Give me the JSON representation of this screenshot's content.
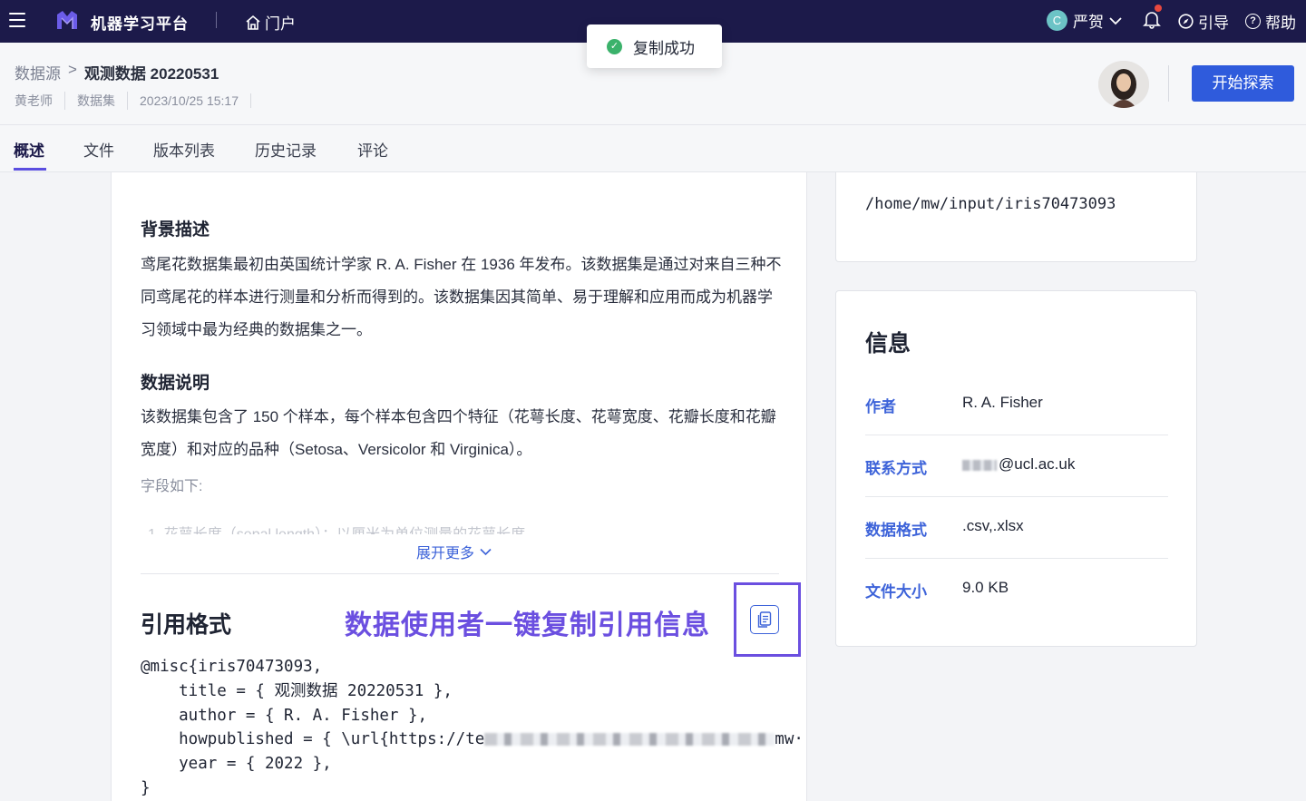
{
  "topbar": {
    "app_title": "机器学习平台",
    "portal_label": "门户",
    "user_initial": "C",
    "user_name": "严贺",
    "guide_label": "引导",
    "help_label": "帮助"
  },
  "toast": {
    "message": "复制成功"
  },
  "header": {
    "breadcrumb_root": "数据源",
    "breadcrumb_sep": ">",
    "breadcrumb_current": "观测数据 20220531",
    "owner": "黄老师",
    "type": "数据集",
    "datetime": "2023/10/25 15:17",
    "explore_button": "开始探索"
  },
  "tabs": [
    "概述",
    "文件",
    "版本列表",
    "历史记录",
    "评论"
  ],
  "overview": {
    "background_title": "背景描述",
    "background_text": "鸢尾花数据集最初由英国统计学家 R. A. Fisher 在 1936 年发布。该数据集是通过对来自三种不同鸢尾花的样本进行测量和分析而得到的。该数据集因其简单、易于理解和应用而成为机器学习领域中最为经典的数据集之一。",
    "data_title": "数据说明",
    "data_text": "该数据集包含了 150 个样本，每个样本包含四个特征（花萼长度、花萼宽度、花瓣长度和花瓣宽度）和对应的品种（Setosa、Versicolor 和 Virginica）。",
    "fields_label": "字段如下:",
    "field_1_partial": "1. 花萼长度（sepal length）：以厘米为单位测量的花萼长度",
    "expand_label": "展开更多"
  },
  "citation": {
    "title": "引用格式",
    "annotation": "数据使用者一键复制引用信息",
    "line1": "@misc{iris70473093,",
    "line2": "    title = { 观测数据 20220531 },",
    "line3": "    author = { R. A. Fisher },",
    "line4_prefix": "    howpublished = { \\url{https://te",
    "line4_suffix": "mw·",
    "line5": "    year = { 2022 },",
    "line6": "}"
  },
  "path_card": {
    "path": "/home/mw/input/iris70473093"
  },
  "info": {
    "title": "信息",
    "rows": [
      {
        "key": "作者",
        "value": "R. A. Fisher"
      },
      {
        "key": "联系方式",
        "value": "@ucl.ac.uk"
      },
      {
        "key": "数据格式",
        "value": ".csv,.xlsx"
      },
      {
        "key": "文件大小",
        "value": "9.0 KB"
      }
    ]
  },
  "colors": {
    "topbar_bg": "#1c1a4a",
    "primary_button": "#2f5bdc",
    "annotation": "#6b4fe0",
    "info_key": "#3d63d9",
    "success": "#3bb26b"
  }
}
